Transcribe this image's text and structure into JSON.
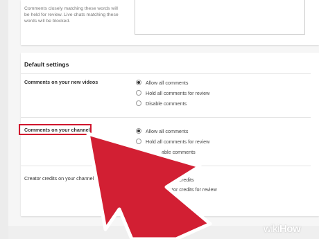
{
  "word_filter": {
    "help_text": "Comments closely matching these words will be held for review. Live chats matching these words will be blocked."
  },
  "default_settings": {
    "title": "Default settings",
    "videos": {
      "label": "Comments on your new videos",
      "options": [
        "Allow all comments",
        "Hold all comments for review",
        "Disable comments"
      ],
      "selected_index": 0
    },
    "channel": {
      "label": "Comments on your channel",
      "options": [
        "Allow all comments",
        "Hold all comments for review",
        "able comments"
      ],
      "selected_index": 0
    },
    "creator_credits": {
      "label": "Creator credits on your channel",
      "options": [
        "ator credits",
        "ator credits for review"
      ]
    }
  },
  "watermark": {
    "prefix": "wiki",
    "suffix": "How"
  },
  "colors": {
    "highlight": "#d0152d",
    "arrow": "#d21f33",
    "arrow_outline": "#ffffff"
  }
}
